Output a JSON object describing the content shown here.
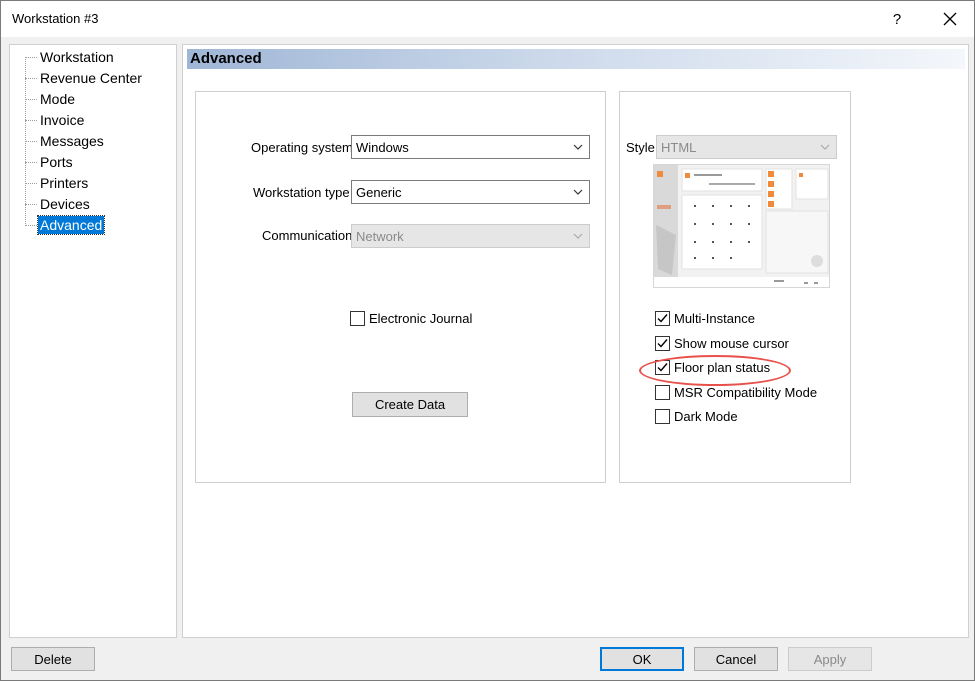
{
  "window": {
    "title": "Workstation #3",
    "help_label": "?",
    "close_icon": "close-icon"
  },
  "tree": {
    "items": [
      {
        "label": "Workstation"
      },
      {
        "label": "Revenue Center"
      },
      {
        "label": "Mode"
      },
      {
        "label": "Invoice"
      },
      {
        "label": "Messages"
      },
      {
        "label": "Ports"
      },
      {
        "label": "Printers"
      },
      {
        "label": "Devices"
      },
      {
        "label": "Advanced",
        "selected": true
      }
    ]
  },
  "section": {
    "title": "Advanced"
  },
  "left_group": {
    "os_label": "Operating system",
    "os_value": "Windows",
    "ws_type_label": "Workstation type",
    "ws_type_value": "Generic",
    "comm_label": "Communication",
    "comm_value": "Network",
    "ej_label": "Electronic Journal",
    "ej_checked": false,
    "create_data_label": "Create Data"
  },
  "right_group": {
    "style_label": "Style",
    "style_value": "HTML",
    "checkboxes": [
      {
        "label": "Multi-Instance",
        "checked": true
      },
      {
        "label": "Show mouse cursor",
        "checked": true
      },
      {
        "label": "Floor plan status",
        "checked": true
      },
      {
        "label": "MSR Compatibility Mode",
        "checked": false
      },
      {
        "label": "Dark Mode",
        "checked": false
      }
    ]
  },
  "footer": {
    "delete_label": "Delete",
    "ok_label": "OK",
    "cancel_label": "Cancel",
    "apply_label": "Apply"
  },
  "colors": {
    "selection": "#0078d7",
    "annotation": "#e8504a",
    "header_gradient_start": "#9fb6d6"
  }
}
